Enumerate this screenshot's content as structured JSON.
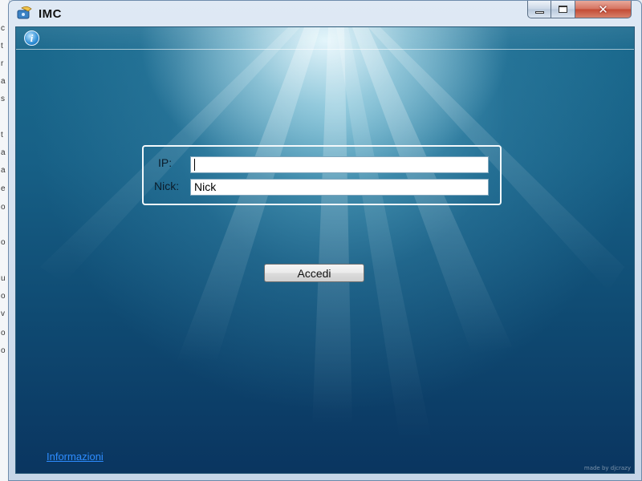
{
  "window": {
    "title": "IMC",
    "caption_buttons": {
      "minimize": "minimize",
      "maximize": "maximize",
      "close": "✕"
    }
  },
  "toolbar": {
    "info_glyph": "i"
  },
  "form": {
    "ip_label": "IP:",
    "ip_value": "",
    "nick_label": "Nick:",
    "nick_value": "Nick"
  },
  "actions": {
    "login_label": "Accedi"
  },
  "footer": {
    "info_link": "Informazioni",
    "made_by": "made by djcrazy"
  },
  "icons": [
    "app-icon",
    "info-icon",
    "minimize-icon",
    "maximize-icon",
    "close-icon"
  ]
}
